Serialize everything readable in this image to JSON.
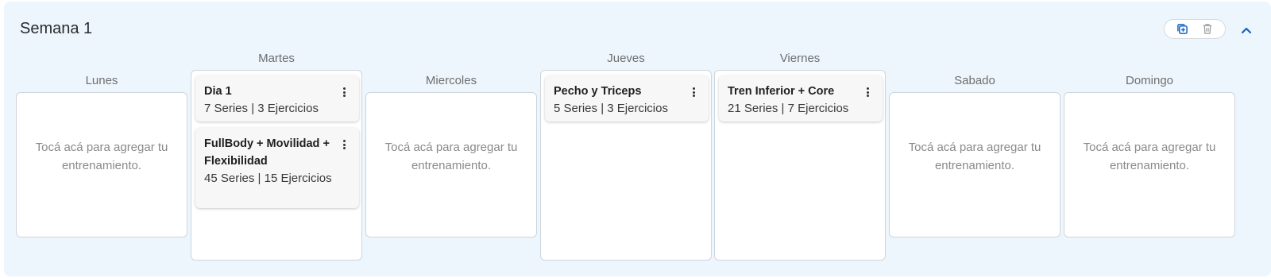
{
  "week": {
    "title": "Semana 1"
  },
  "actions": {
    "duplicate_icon": "copy-plus-icon",
    "delete_icon": "trash-icon",
    "collapse_icon": "chevron-up-icon"
  },
  "colors": {
    "panel_bg": "#edf5fd",
    "accent": "#1565c0"
  },
  "days": [
    {
      "name": "Lunes",
      "empty_text": "Tocá acá para agregar tu entrenamiento.",
      "workouts": []
    },
    {
      "name": "Martes",
      "empty_text": "",
      "workouts": [
        {
          "title": "Dia 1",
          "meta": "7 Series | 3 Ejercicios"
        },
        {
          "title": "FullBody + Movilidad + Flexibilidad",
          "meta": "45 Series | 15 Ejercicios"
        }
      ]
    },
    {
      "name": "Miercoles",
      "empty_text": "Tocá acá para agregar tu entrenamiento.",
      "workouts": []
    },
    {
      "name": "Jueves",
      "empty_text": "",
      "workouts": [
        {
          "title": "Pecho y Triceps",
          "meta": "5 Series | 3 Ejercicios"
        }
      ]
    },
    {
      "name": "Viernes",
      "empty_text": "",
      "workouts": [
        {
          "title": "Tren Inferior + Core",
          "meta": "21 Series | 7 Ejercicios"
        }
      ]
    },
    {
      "name": "Sabado",
      "empty_text": "Tocá acá para agregar tu entrenamiento.",
      "workouts": []
    },
    {
      "name": "Domingo",
      "empty_text": "Tocá acá para agregar tu entrenamiento.",
      "workouts": []
    }
  ]
}
